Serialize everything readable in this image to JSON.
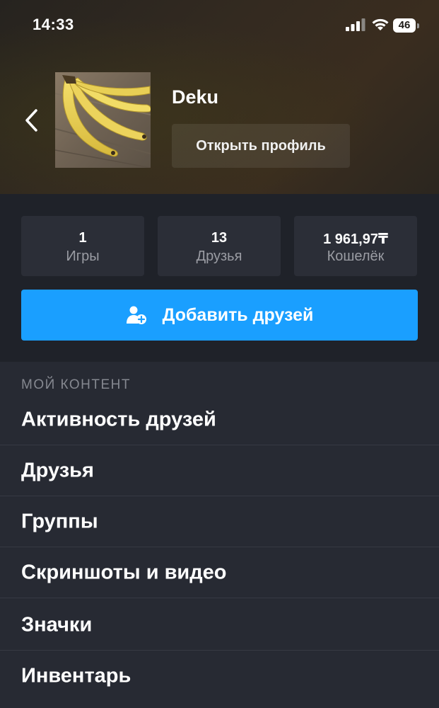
{
  "status_bar": {
    "time": "14:33",
    "battery": "46"
  },
  "profile": {
    "name": "Deku",
    "open_profile_label": "Открыть профиль",
    "avatar_icon": "banana-avatar-icon"
  },
  "stats": [
    {
      "value": "1",
      "label": "Игры"
    },
    {
      "value": "13",
      "label": "Друзья"
    },
    {
      "value": "1 961,97₸",
      "label": "Кошелёк"
    }
  ],
  "add_friends": {
    "label": "Добавить друзей",
    "color": "#1a9fff"
  },
  "content": {
    "section_title": "МОЙ КОНТЕНТ",
    "items": [
      {
        "label": "Активность друзей"
      },
      {
        "label": "Друзья"
      },
      {
        "label": "Группы"
      },
      {
        "label": "Скриншоты и видео"
      },
      {
        "label": "Значки"
      },
      {
        "label": "Инвентарь"
      }
    ]
  }
}
